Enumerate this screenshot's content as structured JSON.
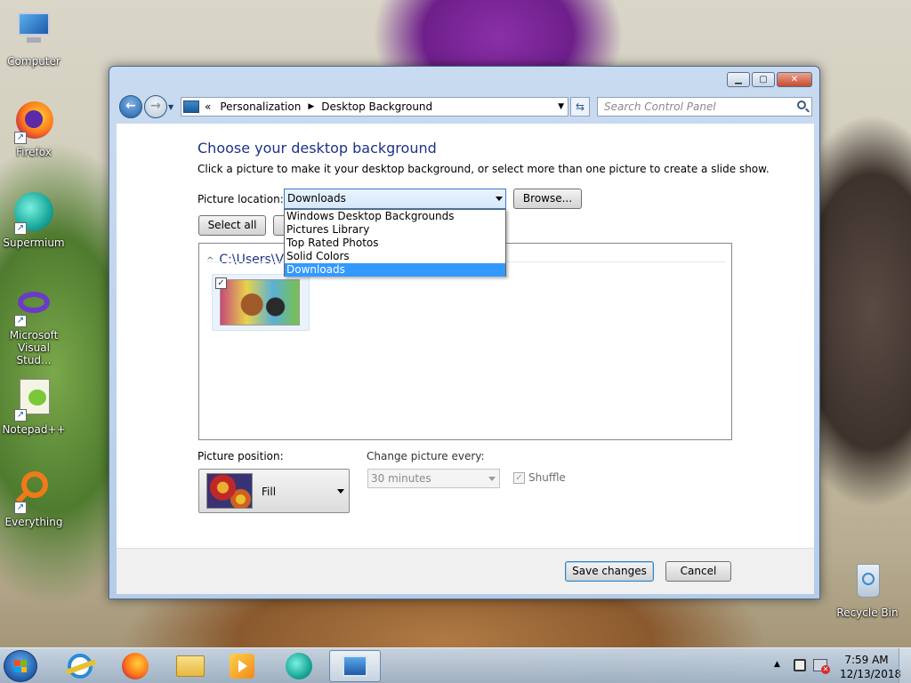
{
  "desktop": {
    "icons": [
      {
        "label": "Computer"
      },
      {
        "label": "Firefox"
      },
      {
        "label": "Supermium"
      },
      {
        "label": "Microsoft Visual Stud..."
      },
      {
        "label": "Notepad++"
      },
      {
        "label": "Everything"
      },
      {
        "label": "Recycle Bin"
      }
    ]
  },
  "window": {
    "caption": {
      "minimize": "▁",
      "maximize": "▢",
      "close": "✕"
    },
    "nav": {
      "back_glyph": "←",
      "forward_glyph": "→",
      "recent_glyph": "▼",
      "breadcrumb_prefix": "«",
      "breadcrumb": [
        "Personalization",
        "Desktop Background"
      ],
      "breadcrumb_sep": "▶",
      "dropdown_glyph": "▼",
      "refresh_glyph": "⇆",
      "search_placeholder": "Search Control Panel"
    },
    "content": {
      "heading": "Choose your desktop background",
      "subtext": "Click a picture to make it your desktop background, or select more than one picture to create a slide show.",
      "picture_location_label": "Picture location:",
      "picture_location_value": "Downloads",
      "browse_label": "Browse...",
      "select_all_label": "Select all",
      "location_options": [
        "Windows Desktop Backgrounds",
        "Pictures Library",
        "Top Rated Photos",
        "Solid Colors",
        "Downloads"
      ],
      "selected_option": "Downloads",
      "folder_chevron": "^",
      "folder_path": "C:\\Users\\VM",
      "thumb_checked_glyph": "✓",
      "picture_position_label": "Picture position:",
      "picture_position_value": "Fill",
      "change_every_label": "Change picture every:",
      "change_every_value": "30 minutes",
      "shuffle_label": "Shuffle",
      "shuffle_glyph": "✓"
    },
    "footer": {
      "save_label": "Save changes",
      "cancel_label": "Cancel"
    }
  },
  "taskbar": {
    "items": [
      "internet-explorer",
      "firefox",
      "file-explorer",
      "media-player",
      "supermium",
      "control-panel"
    ],
    "active_item": "control-panel",
    "tray_up_glyph": "▲",
    "clock_time": "7:59 AM",
    "clock_date": "12/13/2018"
  },
  "colors": {
    "heading": "#1e3287",
    "selection": "#3399ff",
    "window_frame": "#b5cce8"
  }
}
